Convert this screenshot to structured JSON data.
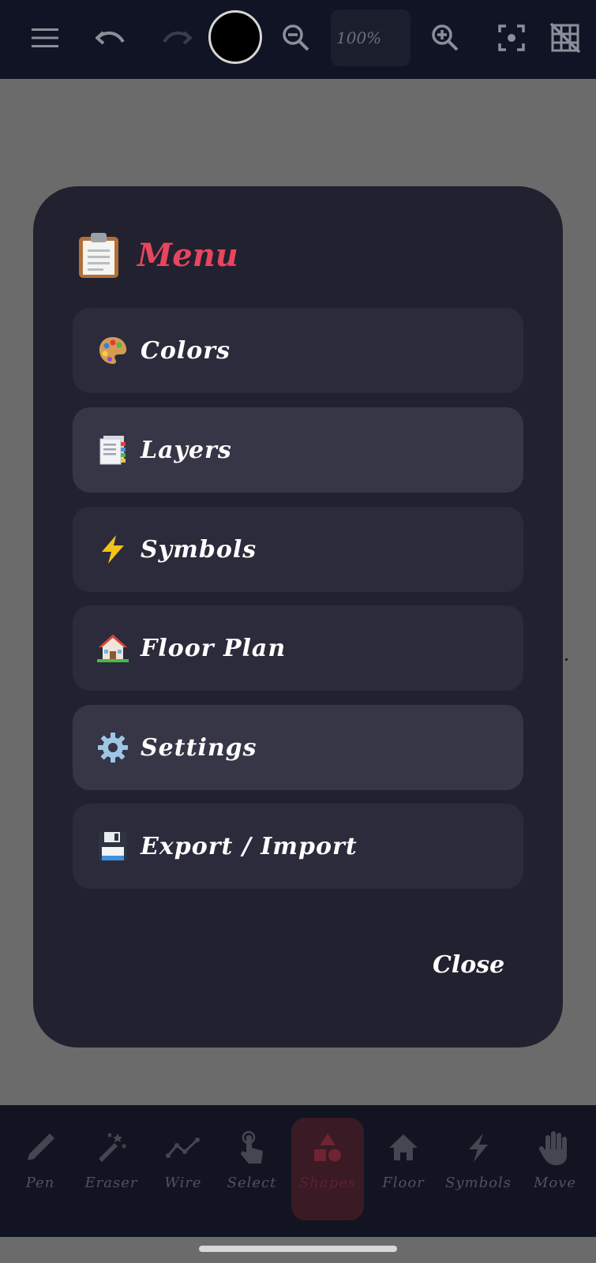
{
  "toolbar": {
    "zoom_level": "100%",
    "current_color": "#000000",
    "icons": [
      "menu-icon",
      "undo-icon",
      "redo-icon",
      "zoom-out-icon",
      "zoom-in-icon",
      "fit-screen-icon",
      "grid-off-icon"
    ]
  },
  "menu": {
    "title": "Menu",
    "title_icon": "clipboard-icon",
    "items": [
      {
        "label": "Colors",
        "icon": "palette-icon"
      },
      {
        "label": "Layers",
        "icon": "layers-icon"
      },
      {
        "label": "Symbols",
        "icon": "lightning-icon"
      },
      {
        "label": "Floor Plan",
        "icon": "house-icon"
      },
      {
        "label": "Settings",
        "icon": "gear-icon"
      },
      {
        "label": "Export / Import",
        "icon": "floppy-disk-icon"
      }
    ],
    "close_label": "Close"
  },
  "tools": [
    {
      "label": "Pen",
      "icon": "pencil-icon"
    },
    {
      "label": "Eraser",
      "icon": "eraser-icon"
    },
    {
      "label": "Wire",
      "icon": "wire-icon"
    },
    {
      "label": "Select",
      "icon": "tap-icon"
    },
    {
      "label": "Shapes",
      "icon": "shapes-icon",
      "active": true
    },
    {
      "label": "Floor",
      "icon": "home-icon"
    },
    {
      "label": "Symbols",
      "icon": "bolt-icon"
    },
    {
      "label": "Move",
      "icon": "hand-icon"
    }
  ],
  "colors": {
    "accent": "#e8455f",
    "toolbar_bg": "#111424",
    "modal_bg": "#21212f",
    "item_bg": "#2b2b3b",
    "canvas_overlay": "#6b6b6b"
  }
}
